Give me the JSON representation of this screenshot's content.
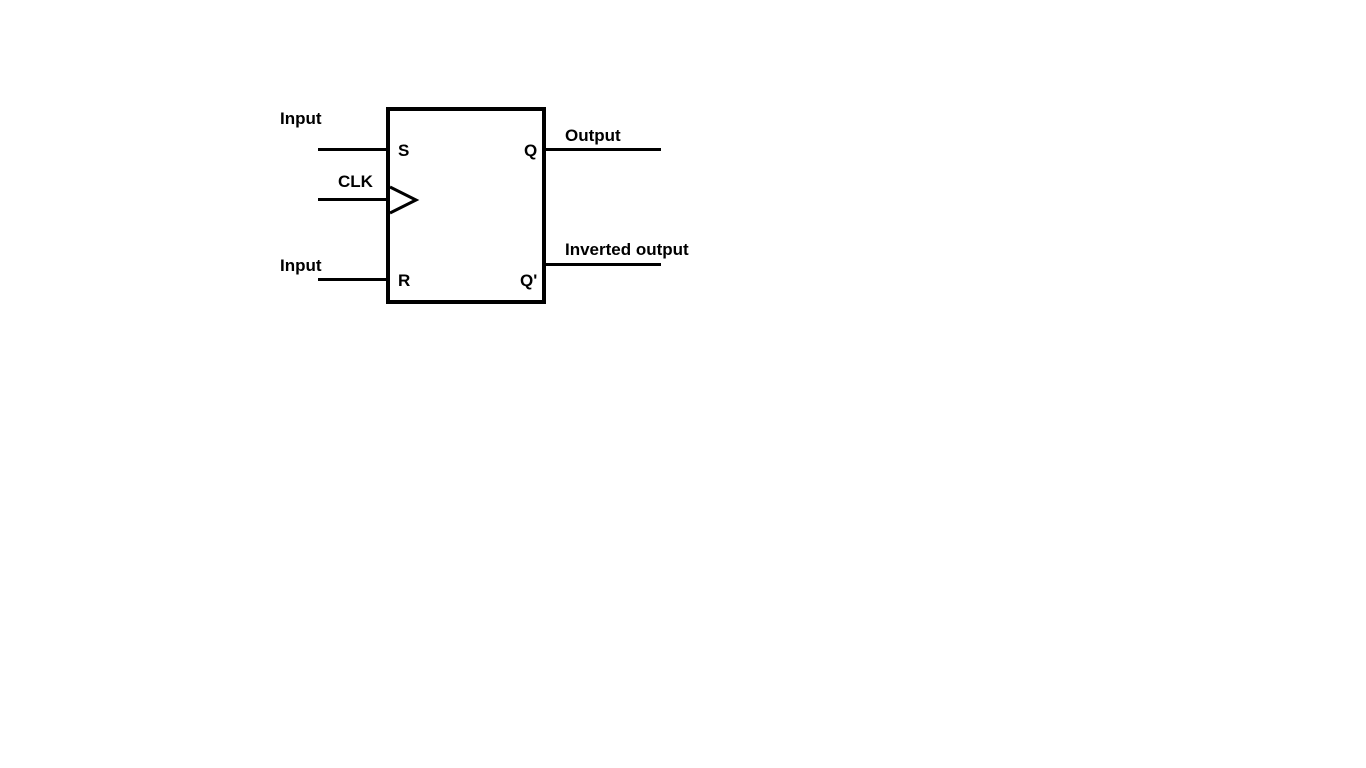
{
  "labels": {
    "input_s": "Input",
    "input_r": "Input",
    "clk": "CLK",
    "output_q": "Output",
    "output_qn": "Inverted output"
  },
  "pins": {
    "s": "S",
    "r": "R",
    "q": "Q",
    "qn": "Q'"
  }
}
